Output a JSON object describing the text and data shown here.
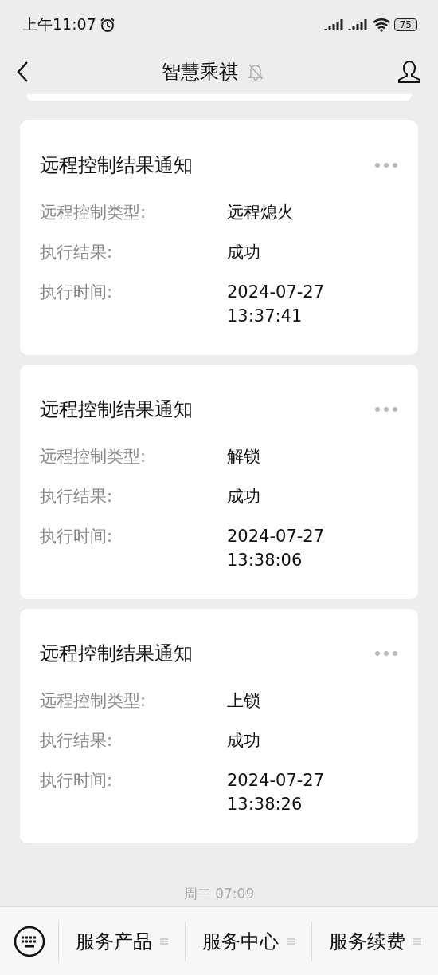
{
  "status_bar": {
    "time": "上午11:07",
    "battery": "75"
  },
  "header": {
    "title": "智慧乘祺",
    "muted": true
  },
  "messages": [
    {
      "title": "远程控制结果通知",
      "rows": [
        {
          "label": "远程控制类型:",
          "value": "远程熄火"
        },
        {
          "label": "执行结果:",
          "value": "成功"
        },
        {
          "label": "执行时间:",
          "value": "2024-07-27 13:37:41"
        }
      ]
    },
    {
      "title": "远程控制结果通知",
      "rows": [
        {
          "label": "远程控制类型:",
          "value": "解锁"
        },
        {
          "label": "执行结果:",
          "value": "成功"
        },
        {
          "label": "执行时间:",
          "value": "2024-07-27\n13:38:06"
        }
      ]
    },
    {
      "title": "远程控制结果通知",
      "rows": [
        {
          "label": "远程控制类型:",
          "value": "上锁"
        },
        {
          "label": "执行结果:",
          "value": "成功"
        },
        {
          "label": "执行时间:",
          "value": "2024-07-27\n13:38:26"
        }
      ]
    }
  ],
  "timestamp": "周二 07:09",
  "menu": [
    {
      "label": "服务产品"
    },
    {
      "label": "服务中心"
    },
    {
      "label": "服务续费"
    }
  ]
}
